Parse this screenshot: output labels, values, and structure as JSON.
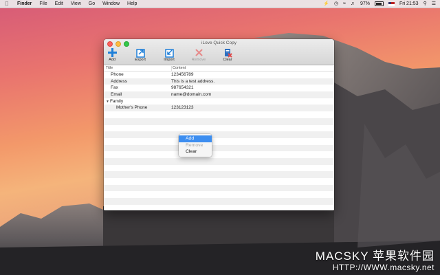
{
  "menubar": {
    "app_name": "Finder",
    "items": [
      "File",
      "Edit",
      "View",
      "Go",
      "Window",
      "Help"
    ],
    "battery": "97%",
    "clock": "Fri 21:53"
  },
  "window": {
    "title": "iLove Quick Copy",
    "toolbar": {
      "add": "Add",
      "export": "Export",
      "import": "Import",
      "remove": "Remove",
      "clear": "Clear"
    },
    "columns": {
      "title": "Title",
      "content": "Content"
    },
    "rows": [
      {
        "title": "Phone",
        "content": "123456789"
      },
      {
        "title": "Address",
        "content": "This is a test address."
      },
      {
        "title": "Fax",
        "content": "987654321"
      },
      {
        "title": "Email",
        "content": "name@domain.com"
      },
      {
        "title": "Family",
        "content": ""
      },
      {
        "title": "Mother's Phone",
        "content": "123123123"
      }
    ]
  },
  "context_menu": {
    "add": "Add",
    "remove": "Remove",
    "clear": "Clear"
  },
  "watermark": {
    "brand": "MACSKY 苹果软件园",
    "url": "HTTP://WWW.macsky.net"
  },
  "colors": {
    "accent": "#3d8ef0",
    "add_icon": "#1e7fd8",
    "remove_icon": "#e04a4a"
  }
}
